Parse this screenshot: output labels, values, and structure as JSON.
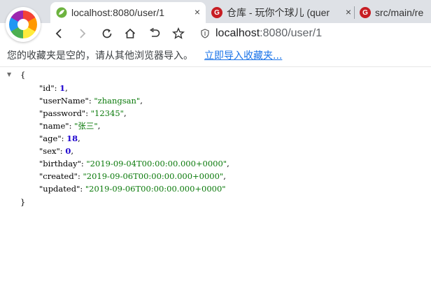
{
  "tabs": [
    {
      "title": "localhost:8080/user/1",
      "close": "×",
      "active": true
    },
    {
      "title": "仓库 - 玩你个球儿 (quer",
      "close": "×",
      "active": false
    },
    {
      "title": "src/main/re",
      "close": "",
      "active": false
    }
  ],
  "tab_favicon_letter": "G",
  "address_bar": {
    "host": "localhost",
    "rest": ":8080/user/1"
  },
  "bookmarks_bar": {
    "message": "您的收藏夹是空的，请从其他浏览器导入。",
    "import_link": "立即导入收藏夹..."
  },
  "json_view": {
    "open_brace": "{",
    "close_brace": "}",
    "toggle": "▼",
    "fields": [
      {
        "key": "\"id\"",
        "sep": ": ",
        "value": "1",
        "type": "number",
        "trail": ","
      },
      {
        "key": "\"userName\"",
        "sep": ": ",
        "value": "\"zhangsan\"",
        "type": "string",
        "trail": ","
      },
      {
        "key": "\"password\"",
        "sep": ": ",
        "value": "\"12345\"",
        "type": "string",
        "trail": ","
      },
      {
        "key": "\"name\"",
        "sep": ": ",
        "value": "\"张三\"",
        "type": "string",
        "trail": ","
      },
      {
        "key": "\"age\"",
        "sep": ": ",
        "value": "18",
        "type": "number",
        "trail": ","
      },
      {
        "key": "\"sex\"",
        "sep": ": ",
        "value": "0",
        "type": "number",
        "trail": ","
      },
      {
        "key": "\"birthday\"",
        "sep": ": ",
        "value": "\"2019-09-04T00:00:00.000+0000\"",
        "type": "string",
        "trail": ","
      },
      {
        "key": "\"created\"",
        "sep": ": ",
        "value": "\"2019-09-06T00:00:00.000+0000\"",
        "type": "string",
        "trail": ","
      },
      {
        "key": "\"updated\"",
        "sep": ": ",
        "value": "\"2019-09-06T00:00:00.000+0000\"",
        "type": "string",
        "trail": ""
      }
    ]
  },
  "colors": {
    "string": "#0b7a0b",
    "number": "#1c00cf",
    "link": "#1a73e8"
  }
}
